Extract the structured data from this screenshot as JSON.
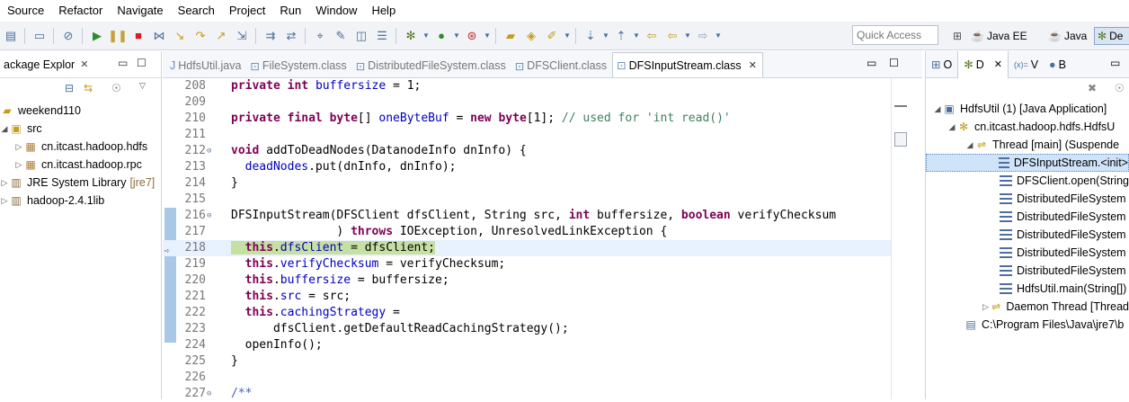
{
  "menubar": {
    "items": [
      "Source",
      "Refactor",
      "Navigate",
      "Search",
      "Project",
      "Run",
      "Window",
      "Help"
    ]
  },
  "toolbar": {
    "quick_access_placeholder": "Quick Access"
  },
  "perspectives": [
    {
      "label": "Java EE"
    },
    {
      "label": "Java"
    },
    {
      "label": "De"
    }
  ],
  "package_explorer": {
    "title": "ackage Explor",
    "tree": [
      {
        "label": "weekend110",
        "suffix": ""
      },
      {
        "label": "src",
        "suffix": ""
      },
      {
        "label": "cn.itcast.hadoop.hdfs",
        "suffix": ""
      },
      {
        "label": "cn.itcast.hadoop.rpc",
        "suffix": ""
      },
      {
        "label": "JRE System Library",
        "suffix": "[jre7]"
      },
      {
        "label": "hadoop-2.4.1lib",
        "suffix": ""
      }
    ]
  },
  "editor": {
    "tabs": [
      "HdfsUtil.java",
      "FileSystem.class",
      "DistributedFileSystem.class",
      "DFSClient.class",
      "DFSInputStream.class"
    ],
    "active_tab": "DFSInputStream.class",
    "line_numbers": [
      "208",
      "209",
      "210",
      "211",
      "212",
      "213",
      "214",
      "215",
      "216",
      "217",
      "218",
      "219",
      "220",
      "221",
      "222",
      "223",
      "224",
      "225",
      "226",
      "227"
    ]
  },
  "debug_view": {
    "tabs": [
      {
        "icon": "outline-icon",
        "label": "O"
      },
      {
        "icon": "debug-icon",
        "label": "D"
      },
      {
        "icon": "variables-icon",
        "label": "V"
      },
      {
        "icon": "breakpoints-icon",
        "label": "B"
      }
    ],
    "tree": [
      {
        "label": "HdfsUtil (1) [Java Application]"
      },
      {
        "label": "cn.itcast.hadoop.hdfs.HdfsU"
      },
      {
        "label": "Thread [main] (Suspende"
      },
      {
        "label": "DFSInputStream.<init>"
      },
      {
        "label": "DFSClient.open(String"
      },
      {
        "label": "DistributedFileSystem"
      },
      {
        "label": "DistributedFileSystem"
      },
      {
        "label": "DistributedFileSystem"
      },
      {
        "label": "DistributedFileSystem"
      },
      {
        "label": "DistributedFileSystem"
      },
      {
        "label": "HdfsUtil.main(String[])"
      },
      {
        "label": "Daemon Thread [Thread"
      },
      {
        "label": "C:\\Program Files\\Java\\jre7\\b"
      }
    ]
  }
}
